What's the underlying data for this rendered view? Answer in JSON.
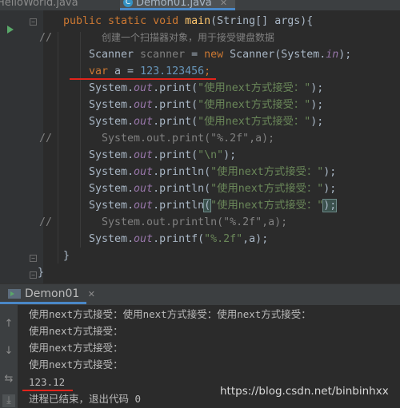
{
  "tabs": [
    {
      "label": "HelloWorld.java",
      "active": false
    },
    {
      "label": "Demon01.java",
      "active": true
    }
  ],
  "editor": {
    "lines": {
      "l1": {
        "kw1": "public static void ",
        "meth": "main",
        "rest": "(String[] args){"
      },
      "l2": {
        "comment": "创建一个扫描器对象，用于接受键盘数据"
      },
      "l3": {
        "a": "Scanner ",
        "b": "scanner",
        "c": " = ",
        "kw": "new",
        "d": " Scanner(System.",
        "fld": "in",
        "e": ");"
      },
      "l4": {
        "kw": "var",
        "a": " a = ",
        "num": "123.123456",
        "semi": ";"
      },
      "l5": {
        "a": "System.",
        "fld": "out",
        "b": ".print(",
        "str": "\"使用next方式接受：\"",
        "c": ");"
      },
      "l6": {
        "a": "System.",
        "fld": "out",
        "b": ".print(",
        "str": "\"使用next方式接受：\"",
        "c": ");"
      },
      "l7": {
        "a": "System.",
        "fld": "out",
        "b": ".print(",
        "str": "\"使用next方式接受：\"",
        "c": ");"
      },
      "l8": {
        "comment": "System.out.print(\"%.2f\",a);"
      },
      "l9": {
        "a": "System.",
        "fld": "out",
        "b": ".print(",
        "str": "\"\\n\"",
        "c": ");"
      },
      "l10": {
        "a": "System.",
        "fld": "out",
        "b": ".println(",
        "str": "\"使用next方式接受：\"",
        "c": ");"
      },
      "l11": {
        "a": "System.",
        "fld": "out",
        "b": ".println(",
        "str": "\"使用next方式接受：\"",
        "c": ");"
      },
      "l12": {
        "a": "System.",
        "fld": "out",
        "b": ".println",
        "paren": "(",
        "str": "\"使用next方式接受：\"",
        "c": ");"
      },
      "l13": {
        "comment": "System.out.println(\"%.2f\",a);"
      },
      "l14": {
        "a": "System.",
        "fld": "out",
        "b": ".printf(",
        "str": "\"%.2f\"",
        "c": ",a);"
      },
      "l15": {
        "brace": "}"
      },
      "l16": {
        "brace": "}"
      }
    },
    "comment_marker": "//"
  },
  "run_window": {
    "title": "Demon01",
    "output": [
      "使用next方式接受：使用next方式接受：使用next方式接受：",
      "使用next方式接受：",
      "使用next方式接受：",
      "使用next方式接受：",
      "123.12",
      "进程已结束，退出代码 0"
    ]
  },
  "watermark": "https://blog.csdn.net/binbinhxx",
  "colors": {
    "keyword": "#cc7832",
    "string": "#6a8759",
    "number": "#6897bb",
    "field": "#9876aa",
    "method": "#ffc66d",
    "comment": "#808080",
    "annotation_red": "#e3241b",
    "active_tab_accent": "#4a88c7"
  }
}
